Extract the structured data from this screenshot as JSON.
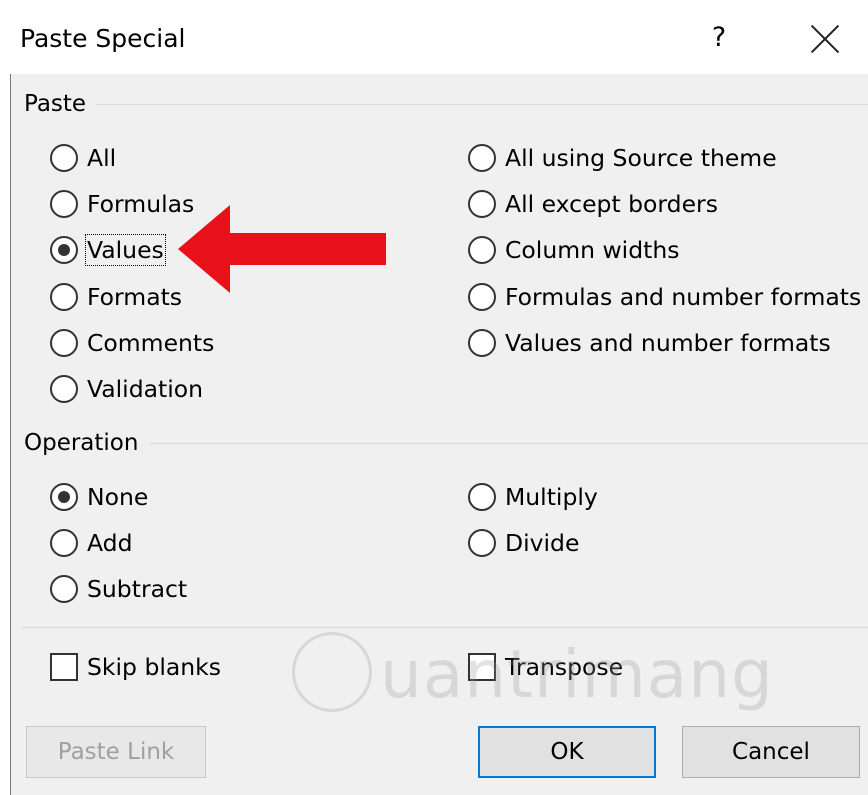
{
  "dialog": {
    "title": "Paste Special",
    "help_label": "?",
    "close_label": "X"
  },
  "paste": {
    "label": "Paste",
    "options_left": [
      {
        "label": "All",
        "selected": false
      },
      {
        "label": "Formulas",
        "selected": false
      },
      {
        "label": "Values",
        "selected": true
      },
      {
        "label": "Formats",
        "selected": false
      },
      {
        "label": "Comments",
        "selected": false
      },
      {
        "label": "Validation",
        "selected": false
      }
    ],
    "options_right": [
      {
        "label": "All using Source theme",
        "selected": false
      },
      {
        "label": "All except borders",
        "selected": false
      },
      {
        "label": "Column widths",
        "selected": false
      },
      {
        "label": "Formulas and number formats",
        "selected": false
      },
      {
        "label": "Values and number formats",
        "selected": false
      }
    ]
  },
  "operation": {
    "label": "Operation",
    "options_left": [
      {
        "label": "None",
        "selected": true
      },
      {
        "label": "Add",
        "selected": false
      },
      {
        "label": "Subtract",
        "selected": false
      }
    ],
    "options_right": [
      {
        "label": "Multiply",
        "selected": false
      },
      {
        "label": "Divide",
        "selected": false
      }
    ]
  },
  "checkboxes": {
    "skip_blanks": {
      "label": "Skip blanks",
      "checked": false
    },
    "transpose": {
      "label": "Transpose",
      "checked": false
    }
  },
  "buttons": {
    "paste_link": "Paste Link",
    "ok": "OK",
    "cancel": "Cancel"
  },
  "annotation": {
    "arrow_color": "#e8111a"
  },
  "watermark": {
    "text": "uantrimang"
  }
}
